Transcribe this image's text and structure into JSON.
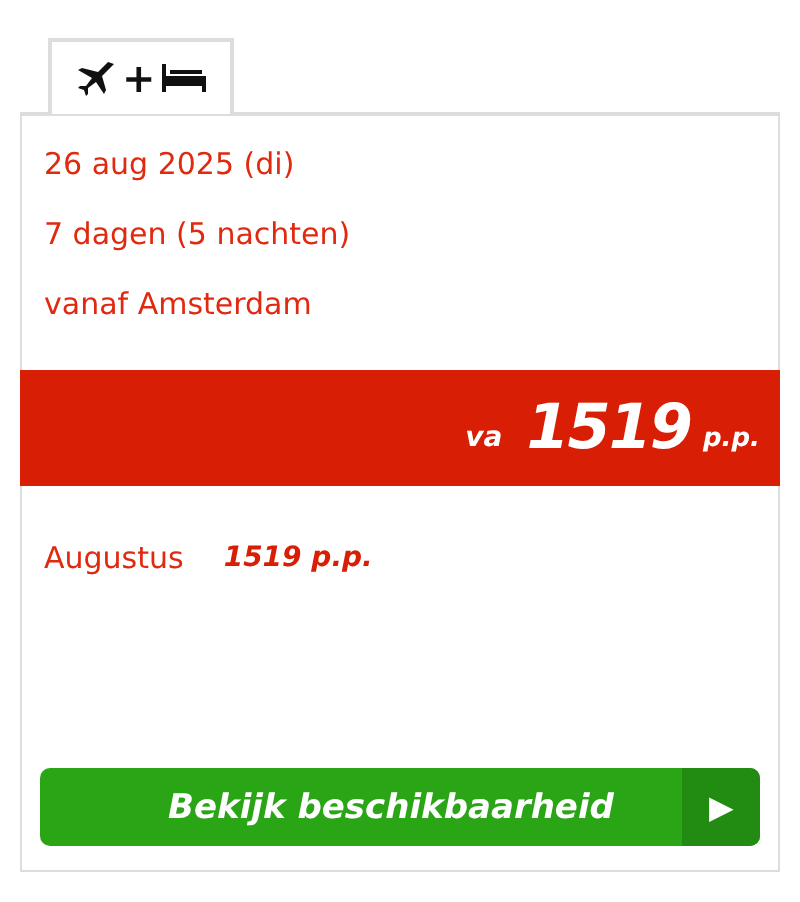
{
  "tab": {
    "separator": "+",
    "selected": true
  },
  "details": [
    "26 aug 2025 (di)",
    "7 dagen (5 nachten)",
    "vanaf Amsterdam"
  ],
  "price_banner": {
    "prefix": "va",
    "price": "1519",
    "suffix": "p.p."
  },
  "months": [
    {
      "month": "Augustus",
      "price": "1519 p.p."
    }
  ],
  "button": {
    "label": "Bekijk beschikbaarheid",
    "arrow": "▶"
  }
}
